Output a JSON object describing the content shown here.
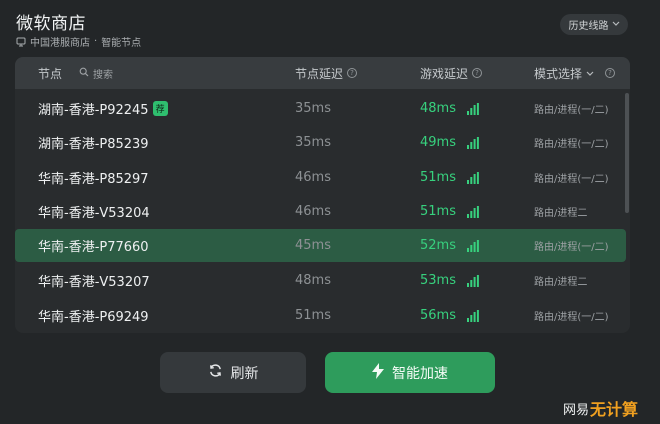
{
  "window": {
    "title": "微软商店",
    "subtitle_server": "中国港服商店",
    "subtitle_sep": "·",
    "subtitle_mode": "智能节点",
    "history_label": "历史线路"
  },
  "table": {
    "headers": {
      "node": "节点",
      "search_placeholder": "搜索",
      "node_latency": "节点延迟",
      "game_latency": "游戏延迟",
      "mode": "模式选择"
    },
    "rows": [
      {
        "name": "湖南-香港-P92245",
        "badge": "荐",
        "node_latency": "35ms",
        "game_latency": "48ms",
        "mode": "路由/进程(一/二)",
        "selected": false
      },
      {
        "name": "湖南-香港-P85239",
        "badge": "",
        "node_latency": "35ms",
        "game_latency": "49ms",
        "mode": "路由/进程(一/二)",
        "selected": false
      },
      {
        "name": "华南-香港-P85297",
        "badge": "",
        "node_latency": "46ms",
        "game_latency": "51ms",
        "mode": "路由/进程(一/二)",
        "selected": false
      },
      {
        "name": "华南-香港-V53204",
        "badge": "",
        "node_latency": "46ms",
        "game_latency": "51ms",
        "mode": "路由/进程二",
        "selected": false
      },
      {
        "name": "华南-香港-P77660",
        "badge": "",
        "node_latency": "45ms",
        "game_latency": "52ms",
        "mode": "路由/进程(一/二)",
        "selected": true
      },
      {
        "name": "华南-香港-V53207",
        "badge": "",
        "node_latency": "48ms",
        "game_latency": "53ms",
        "mode": "路由/进程二",
        "selected": false
      },
      {
        "name": "华南-香港-P69249",
        "badge": "",
        "node_latency": "51ms",
        "game_latency": "56ms",
        "mode": "路由/进程(一/二)",
        "selected": false
      }
    ]
  },
  "actions": {
    "refresh_label": "刷新",
    "accelerate_label": "智能加速"
  },
  "watermark": {
    "prefix": "网易",
    "brand": "无计算"
  },
  "colors": {
    "accent_green": "#2e9c5c",
    "latency_green": "#37d17e",
    "selected_row": "#2c5c44",
    "background": "#232628"
  },
  "icons": {
    "server": "server-icon",
    "chevron": "chevron-down-icon",
    "search": "search-icon",
    "help": "question-circle-icon",
    "signal": "signal-bars-icon",
    "refresh": "refresh-icon",
    "bolt": "lightning-bolt-icon"
  }
}
